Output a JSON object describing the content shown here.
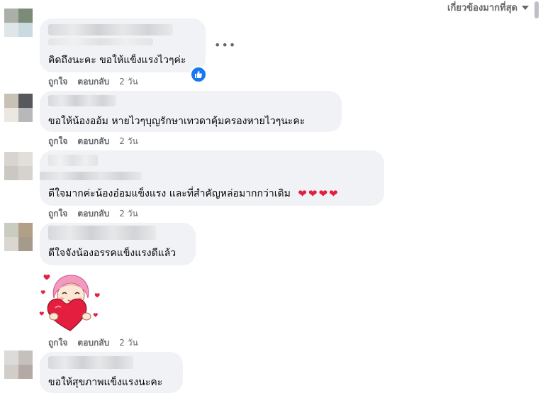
{
  "sort": {
    "label": "เกี่ยวข้องมากที่สุด",
    "icon": "caret-down-icon"
  },
  "more_options": "•••",
  "reaction_icon": "thumbs-up-icon",
  "comments": [
    {
      "text": "คิดถึงนะคะ ขอให้แข็งแรงไวๆค่ะ",
      "like": "ถูกใจ",
      "reply": "ตอบกลับ",
      "time": "2 วัน"
    },
    {
      "text": "ขอให้น้องออ้ม หายไวๆบุญรักษาเทวดาคุ้มครองหายไวๆนะคะ",
      "like": "ถูกใจ",
      "reply": "ตอบกลับ",
      "time": "2 วัน"
    },
    {
      "text": "ดีใจมากค่ะน้องอ๋อมแข็งแรง และที่สำคัญหล่อมากกว่าเดิม",
      "hearts": [
        "❤",
        "❤",
        "❤",
        "❤"
      ],
      "like": "ถูกใจ",
      "reply": "ตอบกลับ",
      "time": "2 วัน"
    },
    {
      "text": "ดีใจจังน้องอรรคแข็งแรงดีแล้ว",
      "like": "ถูกใจ",
      "reply": "ตอบกลับ",
      "time": "2 วัน"
    },
    {
      "text": "ขอให้สุขภาพแข็งแรงนะคะ"
    }
  ],
  "colors": {
    "bubble": "#f0f2f5",
    "meta_text": "#65676b",
    "like_blue": "#1877f2",
    "heart_red": "#e41e3f"
  }
}
